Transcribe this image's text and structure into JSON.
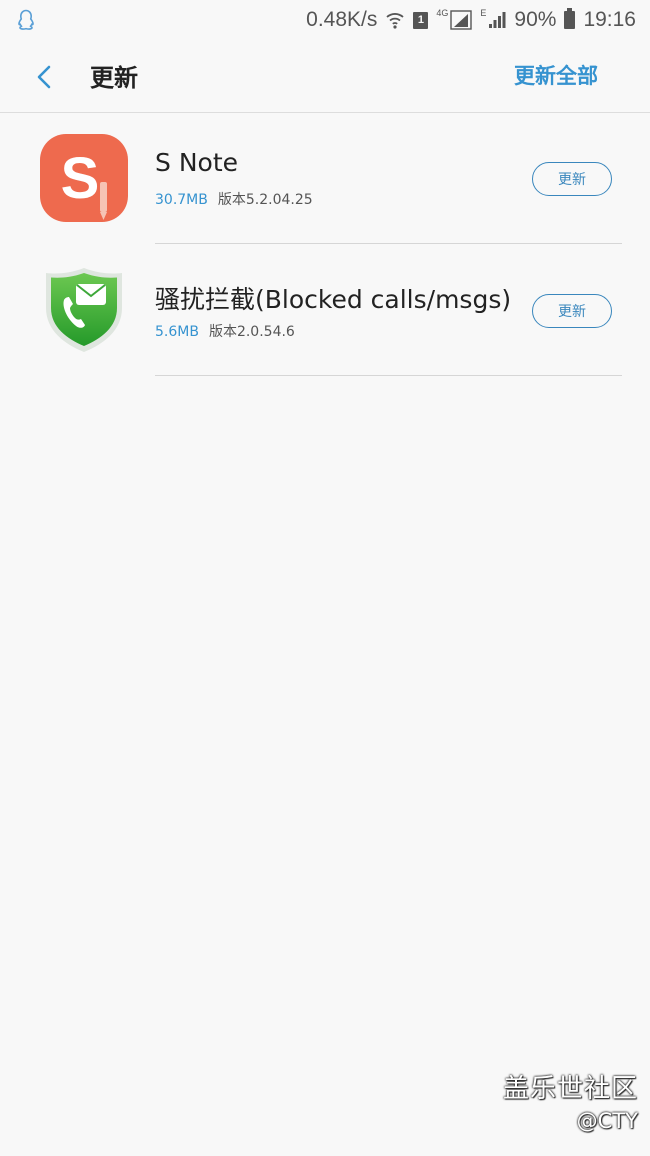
{
  "status_bar": {
    "left_icon": "qq-penguin-icon",
    "network_speed": "0.48K/s",
    "wifi_icon": "wifi-icon",
    "sim_number": "1",
    "network_type_1": "4G",
    "signal_icon_1": "signal-icon",
    "network_type_2": "E",
    "signal_icon_2": "signal-icon",
    "battery": "90%",
    "battery_icon": "battery-icon",
    "time": "19:16"
  },
  "header": {
    "back_icon": "chevron-left-icon",
    "title": "更新",
    "update_all_label": "更新全部"
  },
  "apps": [
    {
      "name": "S Note",
      "size": "30.7MB",
      "version": "版本5.2.04.25",
      "update_label": "更新",
      "icon": "s-note-icon"
    },
    {
      "name": "骚扰拦截(Blocked calls/msgs)",
      "size": "5.6MB",
      "version": "版本2.0.54.6",
      "update_label": "更新",
      "icon": "blocked-calls-shield-icon"
    }
  ],
  "watermark": {
    "line1": "盖乐世社区",
    "line2": "@CTY"
  },
  "colors": {
    "background": "#f8f8f8",
    "accent": "#3693d0",
    "s_note_orange": "#ee6a4e",
    "shield_green": "#3ea83a"
  }
}
